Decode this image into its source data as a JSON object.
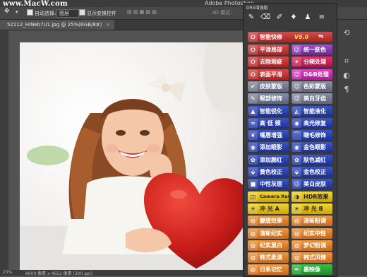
{
  "watermark": "www.MacW.com",
  "app_title": "Adobe Photoshop",
  "options": {
    "auto_select_label": "自动选择:",
    "auto_select_value": "图层",
    "show_transform_label": "显示变换控件",
    "mode_label": "3D 模式:"
  },
  "document_tab": {
    "label": "52112_HINeb7U1.jpg @ 25%(RGB/8#)",
    "close": "×"
  },
  "statusbar": {
    "zoom": "25%",
    "doc_size": "8600 像素 x 4652 像素 (300 ppi)"
  },
  "panel": {
    "title": "DR5增强版",
    "top_button": "智能快修",
    "version": "V5.0",
    "buttons": [
      {
        "label": "平滑局部",
        "color": "red",
        "icon": "lasso-icon"
      },
      {
        "label": "统一肤色",
        "color": "purple",
        "icon": "face-icon"
      },
      {
        "label": "去除瑕疵",
        "color": "red",
        "icon": "lasso-icon"
      },
      {
        "label": "分频处理",
        "color": "magenta",
        "icon": "star-icon"
      },
      {
        "label": "表面平滑",
        "color": "red",
        "icon": "lasso-icon"
      },
      {
        "label": "D&B处理",
        "color": "pink",
        "icon": "face-icon"
      },
      {
        "label": "皮肤蒙版",
        "color": "gray",
        "icon": "check-icon"
      },
      {
        "label": "色彩蒙版",
        "color": "gray",
        "icon": "face-icon"
      },
      {
        "label": "眼部修饰",
        "color": "gray",
        "icon": "brush-icon"
      },
      {
        "label": "美白牙齿",
        "color": "gray",
        "icon": "face-icon"
      },
      {
        "label": "智能锐化",
        "color": "blue",
        "icon": "triangle-icon"
      },
      {
        "label": "智能液化",
        "color": "blue",
        "icon": "shape-icon"
      },
      {
        "label": "高 低 频",
        "color": "blue",
        "icon": "wave-icon"
      },
      {
        "label": "高光修复",
        "color": "blue",
        "icon": "eye-icon"
      },
      {
        "label": "嘴唇增强",
        "color": "blue",
        "icon": "lips-icon"
      },
      {
        "label": "睫毛修饰",
        "color": "blue",
        "icon": "lash-icon"
      },
      {
        "label": "添加眼影",
        "color": "blue",
        "icon": "eye-icon"
      },
      {
        "label": "金色眼影",
        "color": "blue",
        "icon": "eye-icon"
      },
      {
        "label": "添加腮红",
        "color": "blue",
        "icon": "blush-icon"
      },
      {
        "label": "肤色减红",
        "color": "blue",
        "icon": "blush-icon"
      },
      {
        "label": "黄色校正",
        "color": "blue",
        "icon": "dropper-icon"
      },
      {
        "label": "金色校正",
        "color": "blue",
        "icon": "dropper-icon"
      },
      {
        "label": "中性灰层",
        "color": "blue",
        "icon": "gray-square-icon"
      },
      {
        "label": "美白皮肤",
        "color": "blue",
        "icon": "face-icon"
      },
      {
        "label": "Camera Raw",
        "color": "yellow",
        "icon": "camera-icon"
      },
      {
        "label": "HDR效果",
        "color": "yellow",
        "icon": "hdr-icon"
      },
      {
        "label": "冲 光 A",
        "color": "yellow",
        "icon": "sun-icon"
      },
      {
        "label": "冲 光 B",
        "color": "yellow",
        "icon": "sun-icon"
      },
      {
        "label": "朦胧效果",
        "color": "orange",
        "icon": "mist-icon"
      },
      {
        "label": "清新粉调",
        "color": "orange",
        "icon": "mist-icon"
      },
      {
        "label": "清新纪实",
        "color": "orange",
        "icon": "mist-icon"
      },
      {
        "label": "纪实中性",
        "color": "orange",
        "icon": "mist-icon"
      },
      {
        "label": "纪实黑白",
        "color": "orange",
        "icon": "mist-icon"
      },
      {
        "label": "梦幻粉调",
        "color": "orange",
        "icon": "mist-icon"
      },
      {
        "label": "韩式柔调",
        "color": "orange",
        "icon": "mist-icon"
      },
      {
        "label": "韩式风情",
        "color": "orange",
        "icon": "mist-icon"
      },
      {
        "label": "日系记忆",
        "color": "orange",
        "icon": "mist-icon"
      },
      {
        "label": "墨映像",
        "color": "green",
        "icon": "ink-icon"
      }
    ]
  },
  "colors": {
    "red": "#c23333",
    "blue": "#2a3fb0",
    "purple": "#8a3ab8",
    "pink": "#c82fae",
    "magenta": "#cf2458",
    "gray": "#747990",
    "yellow": "#e8c41e",
    "orange": "#e07d2a",
    "green": "#2aa536"
  }
}
